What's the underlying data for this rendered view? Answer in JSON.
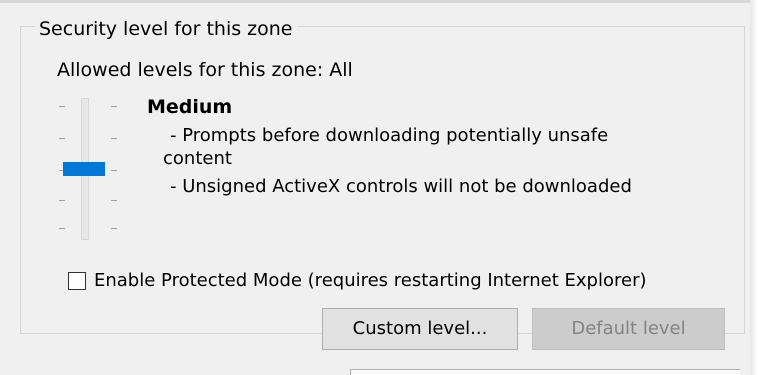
{
  "group": {
    "title": "Security level for this zone",
    "allowed_levels": "Allowed levels for this zone: All"
  },
  "slider": {
    "level_name": "Medium",
    "level_position": "3 of 5",
    "accent_color": "#0078d7",
    "description_lines": [
      "- Prompts before downloading potentially unsafe",
      "content",
      "- Unsigned ActiveX controls will not be downloaded"
    ]
  },
  "protected_mode": {
    "label": "Enable Protected Mode (requires restarting Internet Explorer)",
    "checked": false
  },
  "buttons": {
    "custom_level": "Custom level...",
    "default_level": "Default level"
  }
}
